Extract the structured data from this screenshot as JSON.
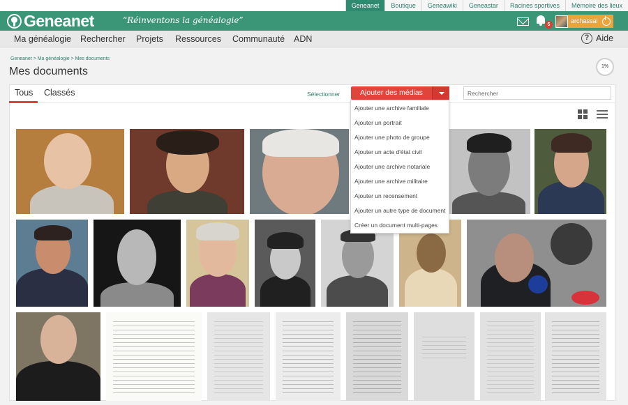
{
  "top_sites": [
    "Geneanet",
    "Boutique",
    "Geneawiki",
    "Geneastar",
    "Racines sportives",
    "Mémoire des lieux"
  ],
  "logo": "Geneanet",
  "slogan": "“Réinventons la généalogie”",
  "notifications_count": "5",
  "username": "archassal",
  "nav": [
    "Ma généalogie",
    "Rechercher",
    "Projets",
    "Ressources",
    "Communauté",
    "ADN"
  ],
  "help_label": "Aide",
  "breadcrumb": "Geneanet > Ma généalogie > Mes documents",
  "page_title": "Mes documents",
  "progress_label": "1%",
  "tabs": [
    "Tous",
    "Classés"
  ],
  "select_label": "Sélectionner",
  "add_button_label": "Ajouter des médias",
  "search_placeholder": "Rechercher",
  "dropdown_items": [
    "Ajouter une archive familiale",
    "Ajouter un portrait",
    "Ajouter une photo de groupe",
    "Ajouter un acte d'état civil",
    "Ajouter une archive notariale",
    "Ajouter une archive militaire",
    "Ajouter un recensement",
    "Ajouter un autre type de document",
    "Créer un document multi-pages"
  ],
  "colors": {
    "brand_green": "#3a9677",
    "accent_red": "#e0443a",
    "user_orange": "#e9a43c",
    "link_green": "#2f7e6b"
  },
  "icons": [
    "geneanet-logo-icon",
    "mail-icon",
    "bell-icon",
    "power-icon",
    "help-icon",
    "caret-down-icon",
    "grid-view-icon",
    "list-view-icon"
  ]
}
